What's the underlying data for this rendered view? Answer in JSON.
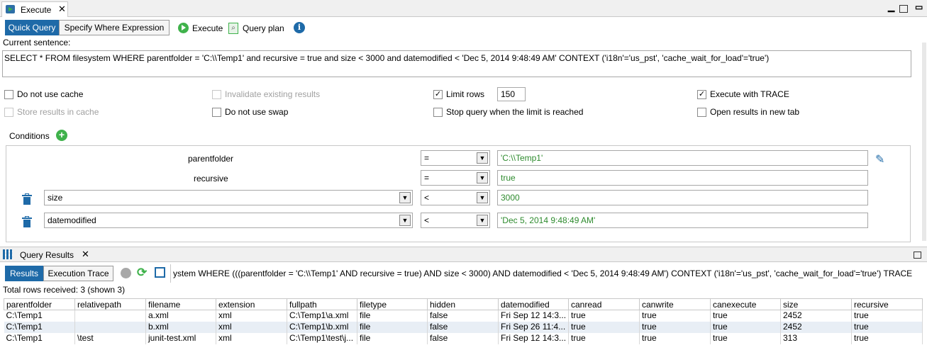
{
  "tab": {
    "title": "Execute"
  },
  "toolbar": {
    "quick_query": "Quick Query",
    "specify_where": "Specify Where Expression",
    "execute": "Execute",
    "query_plan": "Query plan"
  },
  "current_sentence_label": "Current sentence:",
  "sentence": "SELECT * FROM filesystem WHERE parentfolder = 'C:\\\\Temp1' and recursive = true and size < 3000 and datemodified < 'Dec 5, 2014 9:48:49 AM' CONTEXT ('i18n'='us_pst', 'cache_wait_for_load'='true')",
  "options": {
    "do_not_use_cache": {
      "label": "Do not use cache",
      "checked": false
    },
    "invalidate_results": {
      "label": "Invalidate existing results",
      "checked": false
    },
    "limit_rows": {
      "label": "Limit rows",
      "checked": true,
      "value": "150"
    },
    "execute_trace": {
      "label": "Execute with TRACE",
      "checked": true
    },
    "store_results": {
      "label": "Store results in cache",
      "checked": false
    },
    "do_not_use_swap": {
      "label": "Do not use swap",
      "checked": false
    },
    "stop_query": {
      "label": "Stop query when the limit is reached",
      "checked": false
    },
    "open_new_tab": {
      "label": "Open results in new tab",
      "checked": false
    }
  },
  "conditions": {
    "label": "Conditions",
    "rows": [
      {
        "field": "parentfolder",
        "op": "=",
        "value": "'C:\\\\Temp1'"
      },
      {
        "field": "recursive",
        "op": "=",
        "value": "true"
      },
      {
        "field": "size",
        "op": "<",
        "value": "3000"
      },
      {
        "field": "datemodified",
        "op": "<",
        "value": "'Dec 5, 2014 9:48:49 AM'"
      }
    ]
  },
  "results_tab": {
    "title": "Query Results"
  },
  "results_toolbar": {
    "results": "Results",
    "execution_trace": "Execution Trace",
    "query_text": "ystem WHERE (((parentfolder = 'C:\\\\Temp1' AND recursive = true) AND size < 3000) AND datemodified < 'Dec 5, 2014 9:48:49 AM') CONTEXT ('i18n'='us_pst', 'cache_wait_for_load'='true') TRACE"
  },
  "total_rows": "Total rows received: 3 (shown 3)",
  "table": {
    "columns": [
      "parentfolder",
      "relativepath",
      "filename",
      "extension",
      "fullpath",
      "filetype",
      "hidden",
      "datemodified",
      "canread",
      "canwrite",
      "canexecute",
      "size",
      "recursive"
    ],
    "rows": [
      [
        "C:\\Temp1",
        "",
        "a.xml",
        "xml",
        "C:\\Temp1\\a.xml",
        "file",
        "false",
        "Fri Sep 12 14:3...",
        "true",
        "true",
        "true",
        "2452",
        "true"
      ],
      [
        "C:\\Temp1",
        "",
        "b.xml",
        "xml",
        "C:\\Temp1\\b.xml",
        "file",
        "false",
        "Fri Sep 26 11:4...",
        "true",
        "true",
        "true",
        "2452",
        "true"
      ],
      [
        "C:\\Temp1",
        "\\test",
        "junit-test.xml",
        "xml",
        "C:\\Temp1\\test\\j...",
        "file",
        "false",
        "Fri Sep 12 14:3...",
        "true",
        "true",
        "true",
        "313",
        "true"
      ]
    ]
  },
  "colors": {
    "accent": "#1e6aa8",
    "green_value": "#2e8b2e",
    "alt_row": "#e8eef5"
  }
}
